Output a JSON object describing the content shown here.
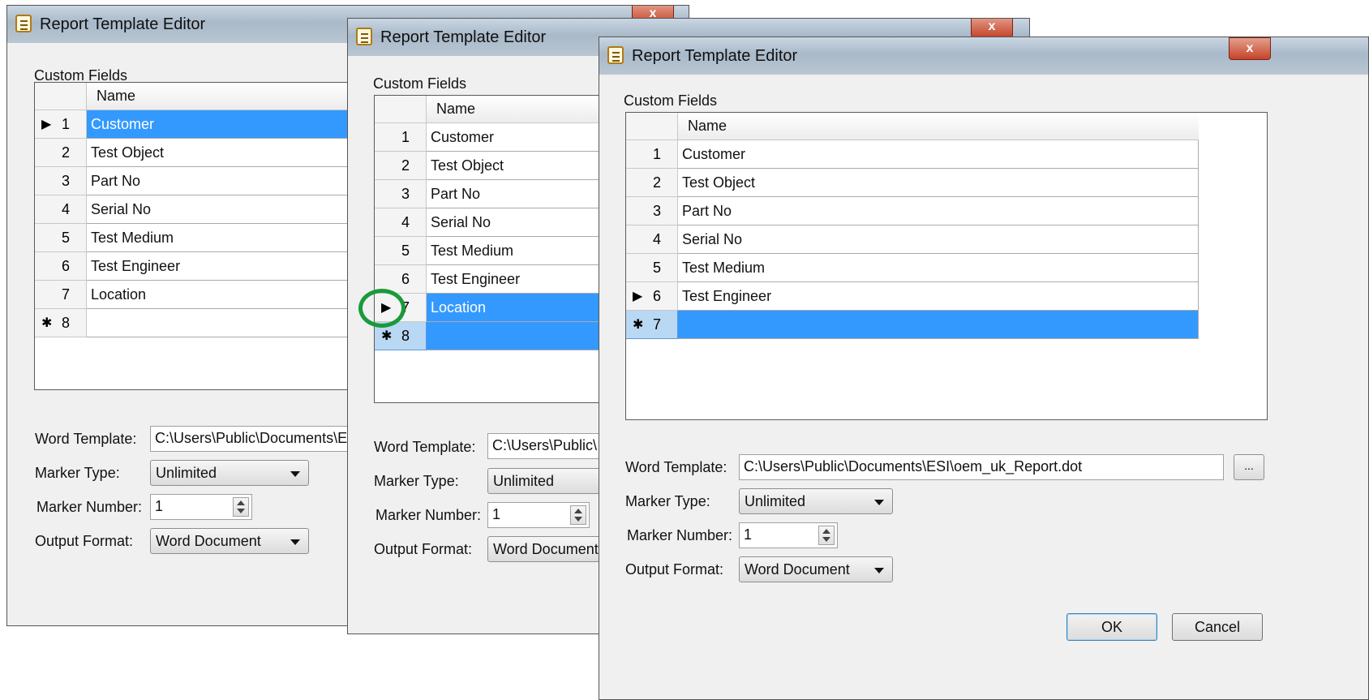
{
  "window": {
    "title": "Report Template Editor",
    "close_glyph": "x",
    "icon": "report-template-icon"
  },
  "labels": {
    "custom_fields": "Custom Fields",
    "name_header": "Name",
    "word_template": "Word Template:",
    "marker_type": "Marker Type:",
    "marker_number": "Marker Number:",
    "output_format": "Output Format:"
  },
  "markers": {
    "current": "▶",
    "new": "✱"
  },
  "dialog1": {
    "rows": [
      {
        "num": "1",
        "name": "Customer",
        "marker": "current"
      },
      {
        "num": "2",
        "name": "Test Object",
        "marker": ""
      },
      {
        "num": "3",
        "name": "Part No",
        "marker": ""
      },
      {
        "num": "4",
        "name": "Serial No",
        "marker": ""
      },
      {
        "num": "5",
        "name": "Test Medium",
        "marker": ""
      },
      {
        "num": "6",
        "name": "Test Engineer",
        "marker": ""
      },
      {
        "num": "7",
        "name": "Location",
        "marker": ""
      },
      {
        "num": "8",
        "name": "",
        "marker": "new"
      }
    ],
    "word_template_value": "C:\\Users\\Public\\Documents\\ESI",
    "marker_type_value": "Unlimited",
    "marker_number_value": "1",
    "output_format_value": "Word Document"
  },
  "dialog2": {
    "rows": [
      {
        "num": "1",
        "name": "Customer",
        "marker": ""
      },
      {
        "num": "2",
        "name": "Test Object",
        "marker": ""
      },
      {
        "num": "3",
        "name": "Part No",
        "marker": ""
      },
      {
        "num": "4",
        "name": "Serial No",
        "marker": ""
      },
      {
        "num": "5",
        "name": "Test Medium",
        "marker": ""
      },
      {
        "num": "6",
        "name": "Test Engineer",
        "marker": ""
      },
      {
        "num": "7",
        "name": "Location",
        "marker": "current"
      },
      {
        "num": "8",
        "name": "",
        "marker": "new"
      }
    ],
    "word_template_value": "C:\\Users\\Public\\",
    "marker_type_value": "Unlimited",
    "marker_number_value": "1",
    "output_format_value": "Word Document"
  },
  "dialog3": {
    "rows": [
      {
        "num": "1",
        "name": "Customer",
        "marker": ""
      },
      {
        "num": "2",
        "name": "Test Object",
        "marker": ""
      },
      {
        "num": "3",
        "name": "Part No",
        "marker": ""
      },
      {
        "num": "4",
        "name": "Serial No",
        "marker": ""
      },
      {
        "num": "5",
        "name": "Test Medium",
        "marker": ""
      },
      {
        "num": "6",
        "name": "Test Engineer",
        "marker": "current"
      },
      {
        "num": "7",
        "name": "",
        "marker": "new"
      }
    ],
    "word_template_value": "C:\\Users\\Public\\Documents\\ESI\\oem_uk_Report.dot",
    "browse_label": "...",
    "marker_type_value": "Unlimited",
    "marker_number_value": "1",
    "output_format_value": "Word Document",
    "ok_label": "OK",
    "cancel_label": "Cancel"
  },
  "colors": {
    "selection": "#3399ff",
    "annotation_circle": "#1a9a3a",
    "close_button": "#c44329"
  }
}
